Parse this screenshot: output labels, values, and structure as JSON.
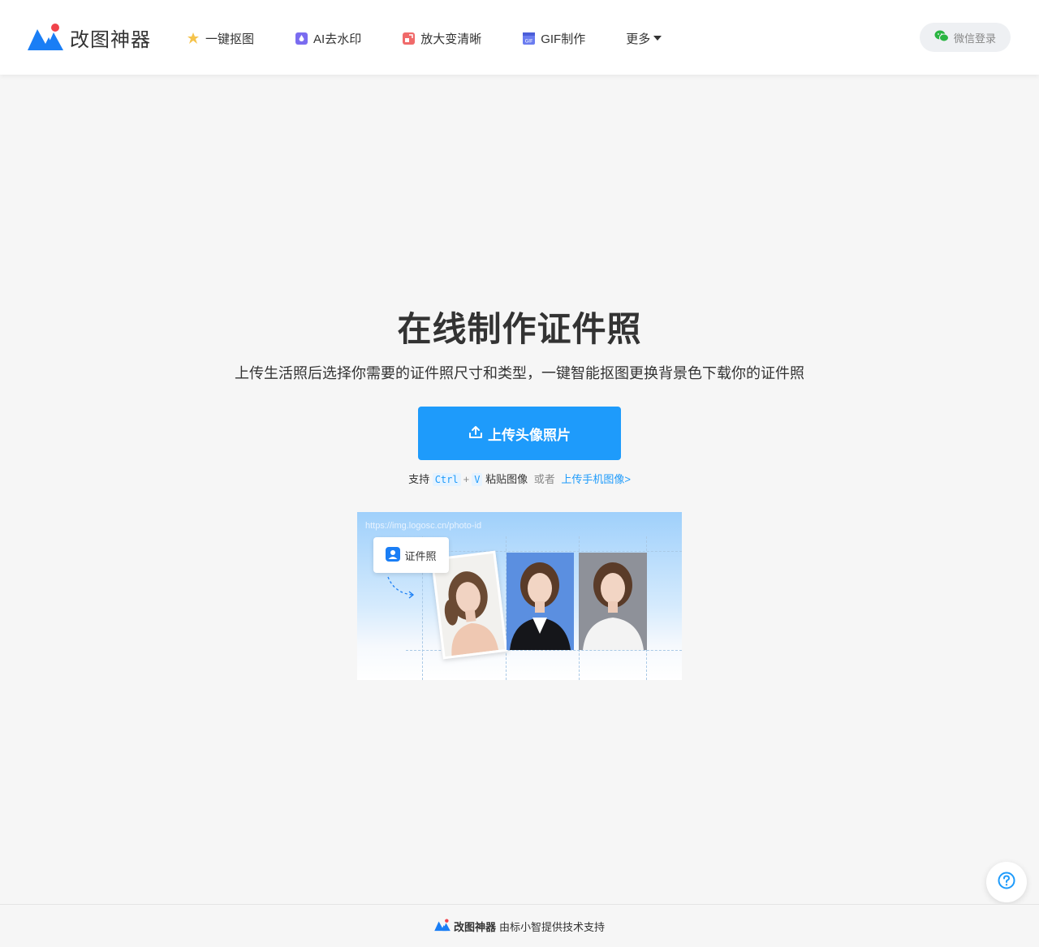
{
  "header": {
    "brand": "改图神器",
    "nav": [
      {
        "label": "一键抠图",
        "icon": "star-sparkle-icon"
      },
      {
        "label": "AI去水印",
        "icon": "ai-watermark-icon"
      },
      {
        "label": "放大变清晰",
        "icon": "enlarge-icon"
      },
      {
        "label": "GIF制作",
        "icon": "gif-icon"
      }
    ],
    "more_label": "更多",
    "login_label": "微信登录"
  },
  "hero": {
    "title": "在线制作证件照",
    "subtitle": "上传生活照后选择你需要的证件照尺寸和类型，一键智能抠图更换背景色下载你的证件照",
    "upload_label": "上传头像照片",
    "hint_support": "支持",
    "hint_key1": "Ctrl",
    "hint_plus": "+",
    "hint_key2": "V",
    "hint_paste": "粘贴图像",
    "hint_or": "或者",
    "hint_mobile": "上传手机图像>"
  },
  "preview": {
    "url": "https://img.logosc.cn/photo-id",
    "tag_label": "证件照"
  },
  "footer": {
    "brand": "改图神器",
    "text": "由标小智提供技术支持"
  },
  "colors": {
    "accent": "#1e9bfb",
    "logo_blue": "#1a7ef5",
    "logo_red": "#f0434b",
    "wechat_green": "#2ab542"
  }
}
